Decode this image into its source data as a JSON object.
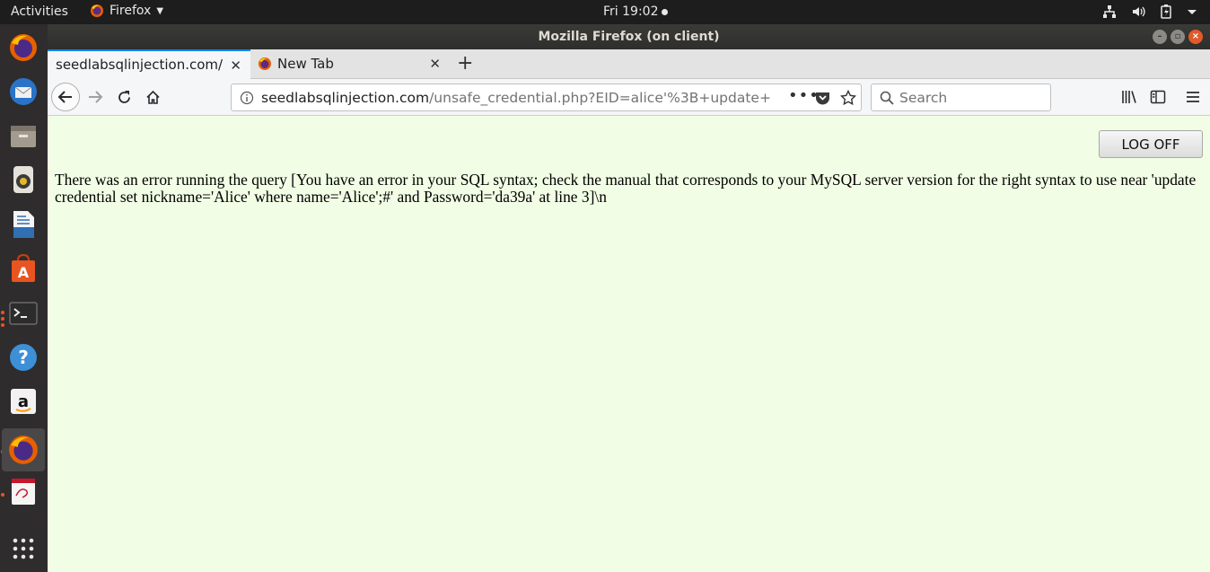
{
  "topbar": {
    "activities": "Activities",
    "app_menu": "Firefox",
    "clock": "Fri 19:02"
  },
  "dock": {
    "items": [
      "firefox-icon",
      "thunderbird-icon",
      "files-icon",
      "rhythmbox-icon",
      "libreoffice-writer-icon",
      "ubuntu-software-icon",
      "terminal-icon",
      "help-icon",
      "amazon-icon",
      "firefox-active-icon",
      "text-editor-icon",
      "show-apps-icon"
    ]
  },
  "window": {
    "title": "Mozilla Firefox (on client)"
  },
  "tabs": [
    {
      "label": "seedlabsqlinjection.com/",
      "selected": true
    },
    {
      "label": "New Tab",
      "selected": false
    }
  ],
  "navbar": {
    "url_host": "seedlabsqlinjection.com",
    "url_rest": "/unsafe_credential.php?EID=alice'%3B+update+",
    "search_placeholder": "Search"
  },
  "page": {
    "logoff_label": "LOG OFF",
    "error_message": "There was an error running the query [You have an error in your SQL syntax; check the manual that corresponds to your MySQL server version for the right syntax to use near 'update credential set nickname='Alice' where name='Alice';#' and Password='da39a' at line 3]\\n"
  },
  "colors": {
    "accent_tab": "#0a84ff",
    "page_bg": "#f1fde4",
    "dock_bg": "#2f2c2d",
    "ubuntu_orange": "#e95420"
  }
}
